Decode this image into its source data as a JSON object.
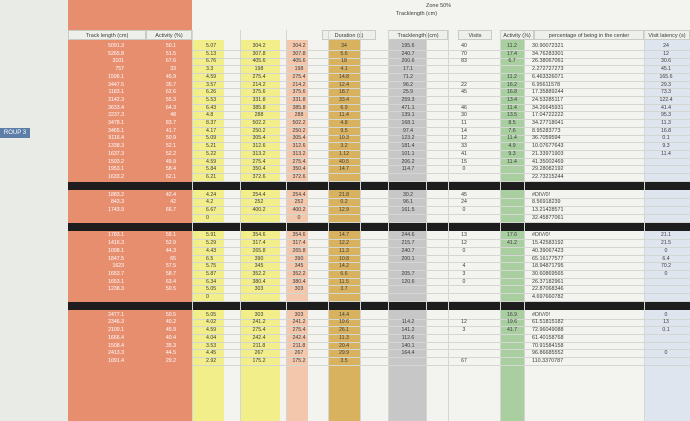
{
  "sheet": {
    "group_label": "ROUP 3",
    "headers": {
      "track_length": "Track length (cm)",
      "activity": "Activity (%)",
      "duration": "Duration (s)",
      "zone_title": "Zone 50%",
      "zone_sub": "Tracklength (cm)",
      "visits": "Visits",
      "activity2": "Activity (%)",
      "pct_center": "percentage of being in the center",
      "visit_latency": "Visit latency (s)"
    },
    "colors": {
      "accent_red": "#e78e6f",
      "yellow": "#f2ee8a",
      "green": "#a9cfa0",
      "mustard": "#d8b25f",
      "black_bar": "#1d1d1d"
    },
    "blocks": [
      {
        "rows": [
          {
            "tl": "5091.3",
            "act": "50.1",
            "c1": "5.07",
            "c2": "304.2",
            "c3": "304.2",
            "pct": "30.90072321"
          },
          {
            "tl": "5265.8",
            "act": "51.5",
            "c1": "5.13",
            "c2": "307.8",
            "c3": "307.8",
            "pct": "34.76283301"
          },
          {
            "tl": "3101",
            "act": "67.6",
            "c1": "6.76",
            "c2": "405.6",
            "c3": "405.6",
            "pct": "26.38067061"
          },
          {
            "tl": "757",
            "act": "33",
            "c1": "3.3",
            "c2": "198",
            "c3": "198",
            "pct": "2.272727273"
          },
          {
            "tl": "1596.1",
            "act": "45.9",
            "c1": "4.59",
            "c2": "275.4",
            "c3": "275.4",
            "pct": "6.463326071"
          },
          {
            "tl": "3447.5",
            "act": "35.7",
            "c1": "3.57",
            "c2": "214.2",
            "c3": "214.2",
            "pct": "6.95611578"
          },
          {
            "tl": "1183.1",
            "act": "62.6",
            "c1": "6.26",
            "c2": "375.6",
            "c3": "375.6",
            "pct": "17.35889244"
          },
          {
            "tl": "3142.3",
            "act": "55.3",
            "c1": "5.53",
            "c2": "331.8",
            "c3": "331.8",
            "pct": "24.53285117"
          },
          {
            "tl": "3633.4",
            "act": "64.3",
            "c1": "6.43",
            "c2": "385.8",
            "c3": "385.8",
            "pct": "34.26645931"
          },
          {
            "tl": "3237.3",
            "act": "48",
            "c1": "4.8",
            "c2": "288",
            "c3": "288",
            "pct": "17.04722222"
          },
          {
            "tl": "3478.1",
            "act": "83.7",
            "c1": "8.37",
            "c2": "502.2",
            "c3": "502.2",
            "pct": "34.27718041"
          },
          {
            "tl": "3465.1",
            "act": "41.7",
            "c1": "4.17",
            "c2": "250.2",
            "c3": "250.2",
            "pct": "8.95283773"
          },
          {
            "tl": "5116.4",
            "act": "50.9",
            "c1": "5.09",
            "c2": "305.4",
            "c3": "305.4",
            "pct": "36.7059594"
          },
          {
            "tl": "1338.3",
            "act": "52.1",
            "c1": "5.21",
            "c2": "312.6",
            "c3": "312.6",
            "pct": "10.07677643"
          },
          {
            "tl": "1637.3",
            "act": "52.2",
            "c1": "5.22",
            "c2": "313.2",
            "c3": "313.2",
            "pct": "21.33971903"
          },
          {
            "tl": "1593.2",
            "act": "45.9",
            "c1": "4.59",
            "c2": "275.4",
            "c3": "275.4",
            "pct": "41.35002469"
          },
          {
            "tl": "1953.1",
            "act": "58.4",
            "c1": "5.84",
            "c2": "350.4",
            "c3": "350.4",
            "pct": "29.28082192"
          },
          {
            "tl": "1633.2",
            "act": "62.1",
            "c1": "6.21",
            "c2": "372.6",
            "c3": "372.6",
            "pct": "22.73215244"
          }
        ]
      },
      {
        "rows": [
          {
            "tl": "1883.2",
            "act": "42.4",
            "c1": "4.24",
            "c2": "254.4",
            "c3": "254.4",
            "pct": "#DIV/0!"
          },
          {
            "tl": "843.3",
            "act": "42",
            "c1": "4.2",
            "c2": "252",
            "c3": "252",
            "pct": "8.56918239"
          },
          {
            "tl": "1743.9",
            "act": "66.7",
            "c1": "6.67",
            "c2": "400.2",
            "c3": "400.2",
            "pct": "13.21428571"
          },
          {
            "tl": "",
            "act": "",
            "c1": "0",
            "c2": "",
            "c3": "0",
            "pct": "32.45877061"
          }
        ]
      },
      {
        "rows": [
          {
            "tl": "1783.1",
            "act": "59.1",
            "c1": "5.91",
            "c2": "354.6",
            "c3": "354.6",
            "pct": "#DIV/0!"
          },
          {
            "tl": "1416.3",
            "act": "52.9",
            "c1": "5.29",
            "c2": "317.4",
            "c3": "317.4",
            "pct": "15.42583192"
          },
          {
            "tl": "1098.1",
            "act": "44.3",
            "c1": "4.43",
            "c2": "265.8",
            "c3": "265.8",
            "pct": "40.39067423"
          },
          {
            "tl": "1847.5",
            "act": "65",
            "c1": "6.5",
            "c2": "390",
            "c3": "390",
            "pct": "65.16177577"
          },
          {
            "tl": "1623",
            "act": "57.5",
            "c1": "5.75",
            "c2": "345",
            "c3": "345",
            "pct": "18.94871795"
          },
          {
            "tl": "1653.7",
            "act": "58.7",
            "c1": "5.87",
            "c2": "352.2",
            "c3": "352.2",
            "pct": "30.60869565"
          },
          {
            "tl": "1653.1",
            "act": "63.4",
            "c1": "6.34",
            "c2": "380.4",
            "c3": "380.4",
            "pct": "26.37182961"
          },
          {
            "tl": "1238.3",
            "act": "50.5",
            "c1": "5.05",
            "c2": "303",
            "c3": "303",
            "pct": "22.87068346"
          },
          {
            "tl": "",
            "act": "",
            "c1": "0",
            "c2": "",
            "c3": "",
            "pct": "4.697660782"
          }
        ]
      },
      {
        "rows": [
          {
            "tl": "2477.1",
            "act": "50.5",
            "c1": "5.05",
            "c2": "303",
            "c3": "303",
            "pct": "#DIV/0!"
          },
          {
            "tl": "2346.3",
            "act": "40.2",
            "c1": "4.02",
            "c2": "241.2",
            "c3": "241.2",
            "pct": "61.51815182"
          },
          {
            "tl": "2100.1",
            "act": "45.9",
            "c1": "4.59",
            "c2": "275.4",
            "c3": "275.4",
            "pct": "72.96049088"
          },
          {
            "tl": "1666.4",
            "act": "40.4",
            "c1": "4.04",
            "c2": "242.4",
            "c3": "242.4",
            "pct": "61.40158768"
          },
          {
            "tl": "1508.4",
            "act": "35.3",
            "c1": "3.53",
            "c2": "211.8",
            "c3": "211.8",
            "pct": "70.91584158"
          },
          {
            "tl": "2413.3",
            "act": "44.5",
            "c1": "4.45",
            "c2": "267",
            "c3": "267",
            "pct": "96.86685552"
          },
          {
            "tl": "1091.4",
            "act": "29.2",
            "c1": "2.92",
            "c2": "175.2",
            "c3": "175.2",
            "pct": "110.3370787"
          }
        ]
      }
    ],
    "right_values": {
      "duration": [
        "34",
        "5.6",
        "18",
        "4.1",
        "14.8",
        "12.4",
        "18.7",
        "33.4",
        "6.9",
        "11.4",
        "4.8",
        "9.5",
        "10.3",
        "3.2",
        "1.12",
        "40.5",
        "14.7",
        "",
        "21.8",
        "0.2",
        "12.9",
        "",
        "14.7",
        "12.2",
        "11.3",
        "10.8",
        "14.2",
        "6.6",
        "11.5",
        "3.7",
        "",
        "14.4",
        "19.6",
        "26.1",
        "11.3",
        "20.4",
        "29.9",
        "3.5"
      ],
      "zone_track": [
        "195.6",
        "240.7",
        "200.6",
        "17.1",
        "71.2",
        "96.2",
        "25.9",
        "259.3",
        "471.1",
        "139.1",
        "168.1",
        "97.4",
        "123.2",
        "181.4",
        "101.1",
        "206.2",
        "114.7",
        "",
        "30.2",
        "96.1",
        "161.5",
        "",
        "244.6",
        "215.7",
        "240.7",
        "200.1",
        "",
        "205.7",
        "120.6",
        "",
        "",
        "",
        "114.2",
        "141.2",
        "112.6",
        "140.1",
        "164.4"
      ],
      "visits": [
        "40",
        "70",
        "83",
        "",
        "",
        "22",
        "45",
        "",
        "46",
        "30",
        "11",
        "14",
        "12",
        "33",
        "41",
        "15",
        "0",
        "",
        "45",
        "24",
        "0",
        "",
        "13",
        "12",
        "0",
        "",
        "4",
        "3",
        "0",
        "",
        "",
        "",
        "12",
        "3",
        "",
        "",
        "",
        "67"
      ],
      "activity2": [
        "11.2",
        "17.4",
        "6.7",
        "",
        "11.2",
        "16.2",
        "16.8",
        "13.4",
        "11.4",
        "13.5",
        "8.5",
        "7.6",
        "11.4",
        "4.9",
        "9.3",
        "11.4",
        "",
        "",
        "",
        "",
        "",
        "",
        "17.6",
        "41.2",
        "",
        "",
        "",
        "",
        "",
        "",
        "",
        "16.9",
        "19.6",
        "41.7",
        "",
        "",
        "",
        ""
      ],
      "latency": [
        "24",
        "12",
        "30.6",
        "45.1",
        "165.6",
        "29.3",
        "73.3",
        "122.4",
        "41.4",
        "95.3",
        "11.3",
        "16.8",
        "0.1",
        "9.3",
        "11.4",
        "",
        "",
        "",
        "",
        "",
        "",
        "",
        "21.1",
        "21.5",
        "0",
        "6.4",
        "70.2",
        "0",
        "",
        "",
        "",
        "0",
        "13",
        "0.1",
        "",
        "",
        "0",
        ""
      ]
    }
  }
}
